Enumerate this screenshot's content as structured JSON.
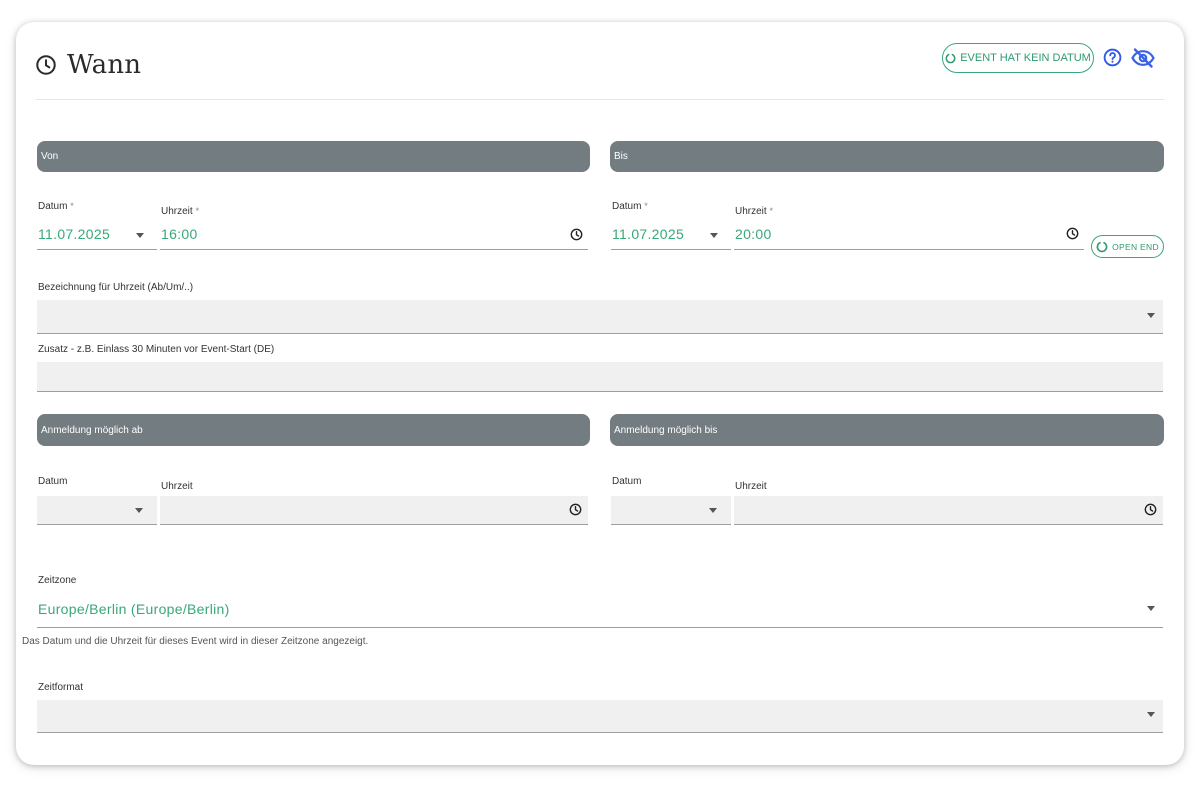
{
  "header": {
    "title": "Wann",
    "no_date_button": "EVENT HAT KEIN DATUM"
  },
  "sections": {
    "from": "Von",
    "to": "Bis",
    "registration_from": "Anmeldung möglich ab",
    "registration_to": "Anmeldung möglich bis"
  },
  "from": {
    "date_label": "Datum",
    "date_value": "11.07.2025",
    "time_label": "Uhrzeit",
    "time_value": "16:00"
  },
  "to": {
    "date_label": "Datum",
    "date_value": "11.07.2025",
    "time_label": "Uhrzeit",
    "time_value": "20:00",
    "open_end_button": "OPEN END"
  },
  "required_marker": "*",
  "time_designation": {
    "label": "Bezeichnung für Uhrzeit (Ab/Um/..)",
    "value": ""
  },
  "additional": {
    "label": "Zusatz - z.B. Einlass 30 Minuten vor Event-Start (DE)",
    "value": ""
  },
  "registration_from": {
    "date_label": "Datum",
    "time_label": "Uhrzeit"
  },
  "registration_to": {
    "date_label": "Datum",
    "time_label": "Uhrzeit"
  },
  "timezone": {
    "label": "Zeitzone",
    "value": "Europe/Berlin (Europe/Berlin)",
    "hint": "Das Datum und die Uhrzeit für dieses Event wird in dieser Zeitzone angezeigt."
  },
  "time_format": {
    "label": "Zeitformat",
    "value": ""
  },
  "colors": {
    "accent": "#3aa77a",
    "section_bar": "#737c80",
    "help_icon": "#2f5bea",
    "hidden_icon": "#3b63e6"
  },
  "icons": {
    "title": "clock-icon",
    "time_fields": "clock-icon",
    "help": "help-circle-icon",
    "visibility": "eye-off-icon",
    "selects": "caret-down-icon"
  }
}
